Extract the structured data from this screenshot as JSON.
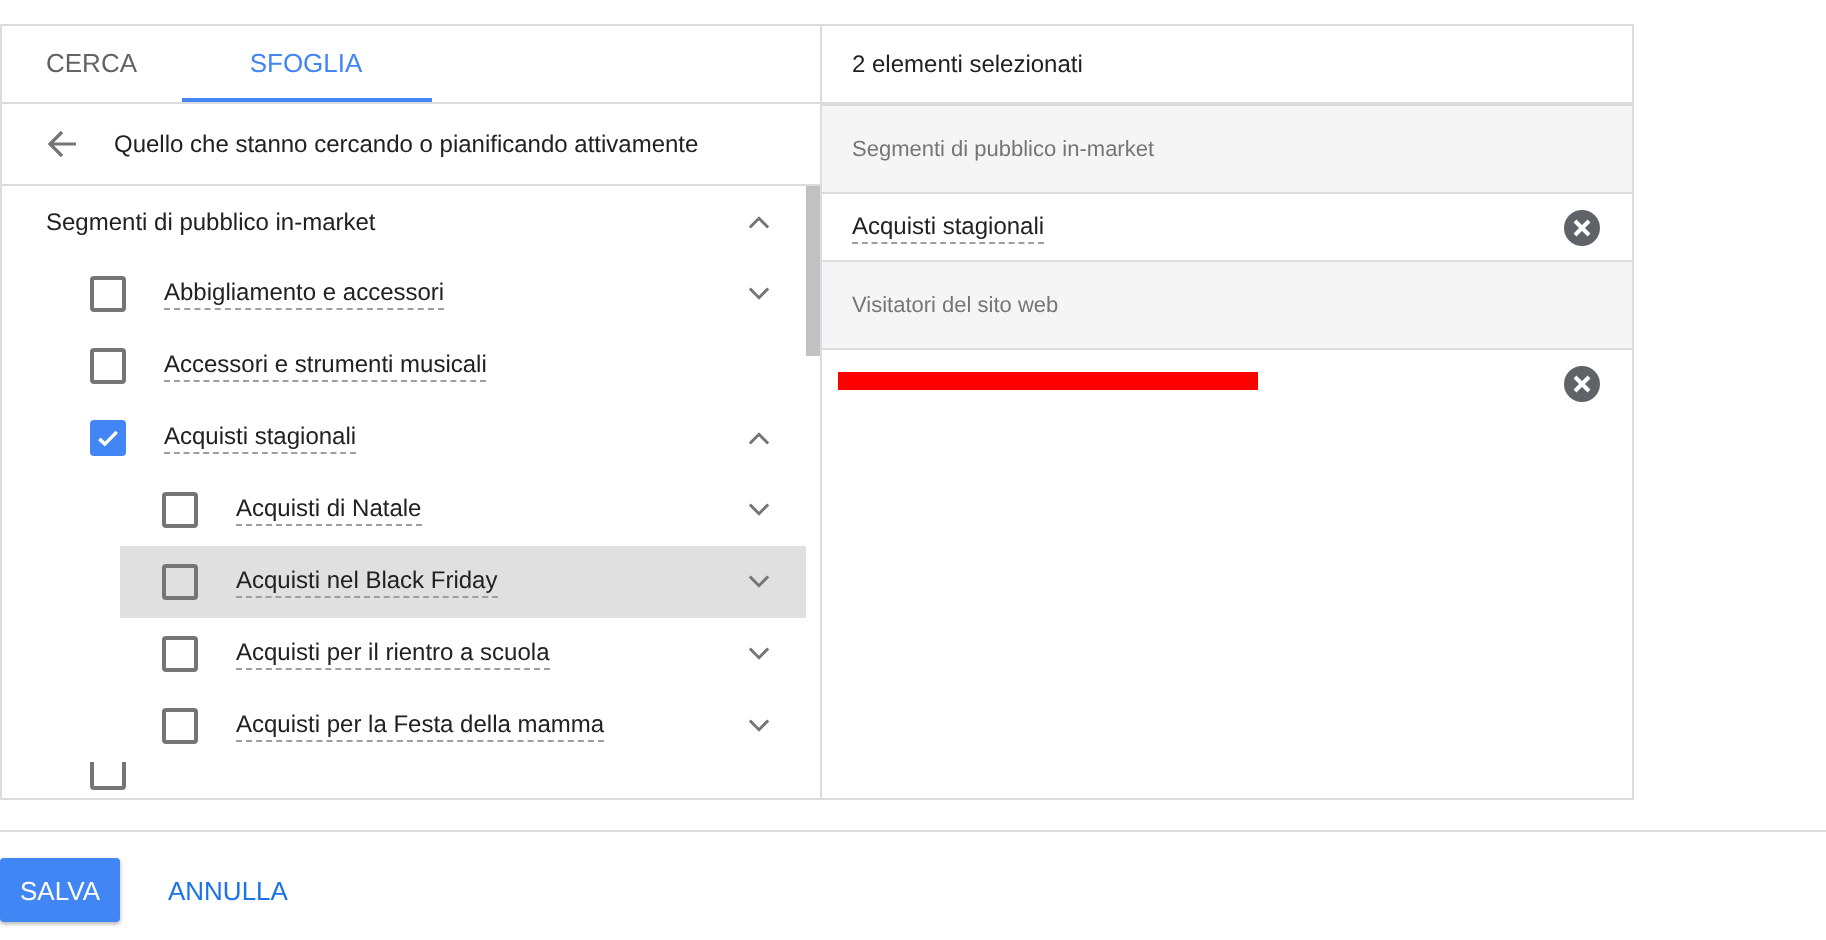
{
  "tabs": [
    {
      "label": "CERCA",
      "selected": false
    },
    {
      "label": "SFOGLIA",
      "selected": true
    }
  ],
  "breadcrumb": {
    "title": "Quello che stanno cercando o pianificando attivamente"
  },
  "tree": {
    "label": "Segmenti di pubblico in-market",
    "expanded": true,
    "children": [
      {
        "label": "Abbigliamento e accessori",
        "kind": "branch",
        "checked": false,
        "expanded": false,
        "highlighted": false
      },
      {
        "label": "Accessori e strumenti musicali",
        "kind": "leaf",
        "checked": false,
        "highlighted": false
      },
      {
        "label": "Acquisti stagionali",
        "kind": "branch",
        "checked": true,
        "expanded": true,
        "highlighted": false,
        "children": [
          {
            "label": "Acquisti di Natale",
            "kind": "branch",
            "checked": false,
            "expanded": false,
            "highlighted": false
          },
          {
            "label": "Acquisti nel Black Friday",
            "kind": "branch",
            "checked": false,
            "expanded": false,
            "highlighted": true
          },
          {
            "label": "Acquisti per il rientro a scuola",
            "kind": "branch",
            "checked": false,
            "expanded": false,
            "highlighted": false
          },
          {
            "label": "Acquisti per la Festa della mamma",
            "kind": "branch",
            "checked": false,
            "expanded": false,
            "highlighted": false
          }
        ]
      },
      {
        "kind": "cut",
        "checked": false
      }
    ]
  },
  "selection": {
    "title": "2 elementi selezionati",
    "groups": [
      {
        "heading": "Segmenti di pubblico in-market",
        "items": [
          {
            "kind": "text",
            "label": "Acquisti stagionali"
          }
        ]
      },
      {
        "heading": "Visitatori del sito web",
        "items": [
          {
            "kind": "redacted"
          }
        ]
      }
    ]
  },
  "buttons": [
    {
      "label": "SALVA",
      "kind": "primary"
    },
    {
      "label": "ANNULLA",
      "kind": "flat"
    }
  ]
}
